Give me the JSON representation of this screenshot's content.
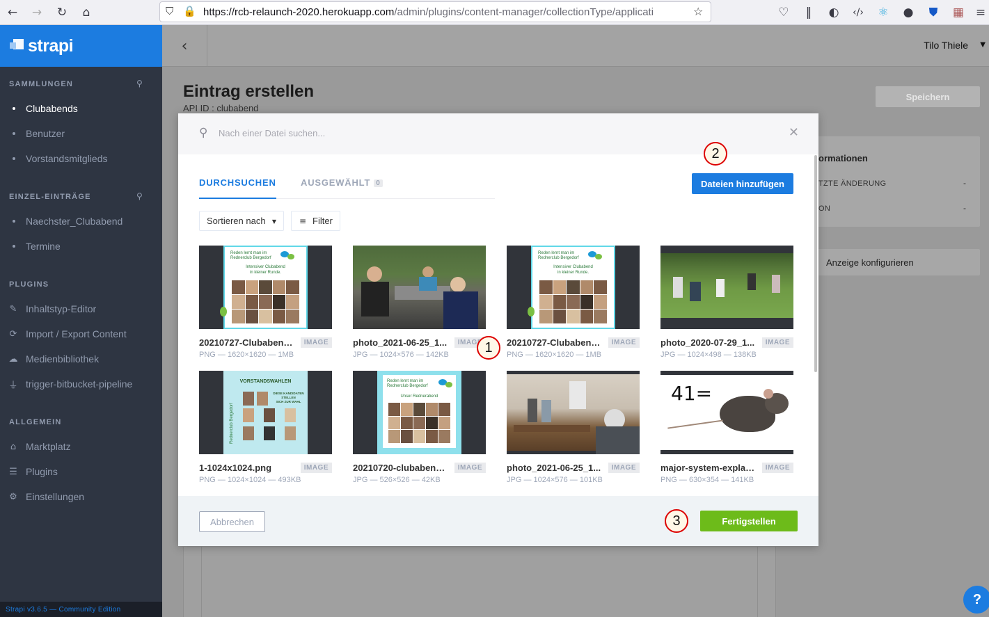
{
  "browser": {
    "url_host": "https://rcb-relaunch-2020.herokuapp.com",
    "url_path": "/admin/plugins/content-manager/collectionType/applicati"
  },
  "sidebar": {
    "logo": "strapi",
    "sections": [
      {
        "title": "SAMMLUNGEN",
        "items": [
          "Clubabends",
          "Benutzer",
          "Vorstandsmitglieds"
        ]
      },
      {
        "title": "EINZEL-EINTRÄGE",
        "items": [
          "Naechster_Clubabend",
          "Termine"
        ]
      },
      {
        "title": "PLUGINS",
        "items": [
          "Inhaltstyp-Editor",
          "Import / Export Content",
          "Medienbibliothek",
          "trigger-bitbucket-pipeline"
        ]
      },
      {
        "title": "ALLGEMEIN",
        "items": [
          "Marktplatz",
          "Plugins",
          "Einstellungen"
        ]
      }
    ],
    "version": "Strapi v3.6.5 — Community Edition"
  },
  "header": {
    "user": "Tilo Thiele"
  },
  "page": {
    "title": "Eintrag erstellen",
    "api_id": "API ID : clubabend",
    "save_label": "Speichern",
    "info_title": "ormationen",
    "info_rows": [
      {
        "label": "TZTE ÄNDERUNG",
        "value": "-"
      },
      {
        "label": "ON",
        "value": "-"
      }
    ],
    "configure_label": "Anzeige konfigurieren",
    "help": "?"
  },
  "modal": {
    "search_placeholder": "Nach einer Datei suchen...",
    "tabs": [
      {
        "label": "DURCHSUCHEN",
        "active": true
      },
      {
        "label": "AUSGEWÄHLT",
        "count": "0"
      }
    ],
    "add_files_label": "Dateien hinzufügen",
    "sort_label": "Sortieren nach",
    "filter_label": "Filter",
    "assets": [
      {
        "name": "20210727-Clubabend...",
        "type": "IMAGE",
        "meta": "PNG — 1620×1620 — 1MB"
      },
      {
        "name": "photo_2021-06-25_1...",
        "type": "IMAGE",
        "meta": "JPG — 1024×576 — 142KB"
      },
      {
        "name": "20210727-Clubabend...",
        "type": "IMAGE",
        "meta": "PNG — 1620×1620 — 1MB"
      },
      {
        "name": "photo_2020-07-29_1...",
        "type": "IMAGE",
        "meta": "JPG — 1024×498 — 138KB"
      },
      {
        "name": "1-1024x1024.png",
        "type": "IMAGE",
        "meta": "PNG — 1024×1024 — 493KB"
      },
      {
        "name": "20210720-clubabend....",
        "type": "IMAGE",
        "meta": "JPG — 526×526 — 42KB"
      },
      {
        "name": "photo_2021-06-25_1...",
        "type": "IMAGE",
        "meta": "JPG — 1024×576 — 101KB"
      },
      {
        "name": "major-system-explana...",
        "type": "IMAGE",
        "meta": "PNG — 630×354 — 141KB"
      }
    ],
    "thumb_text": {
      "flyer_header": "Reden lernt man im\nRednerclub Bergedorf",
      "flyer_1_title": "Intensiver Clubabend\nin kleiner Runde.",
      "flyer_2_title": "Unser Rednerabend",
      "vorstand_title": "VORSTANDSWAHLEN",
      "vorstand_sub": "DIESE KANDIDATEN\nSTELLEN\nSICH ZUR WAHL",
      "vorstand_side": "Rednerclub Bergedorf",
      "rat_text": "41="
    },
    "cancel_label": "Abbrechen",
    "finish_label": "Fertigstellen"
  },
  "annotations": [
    "1",
    "2",
    "3"
  ],
  "colors": {
    "brand": "#1c7ce0",
    "sidebar": "#2e3542",
    "success": "#6dbb1a",
    "annotation": "#dd0000"
  }
}
